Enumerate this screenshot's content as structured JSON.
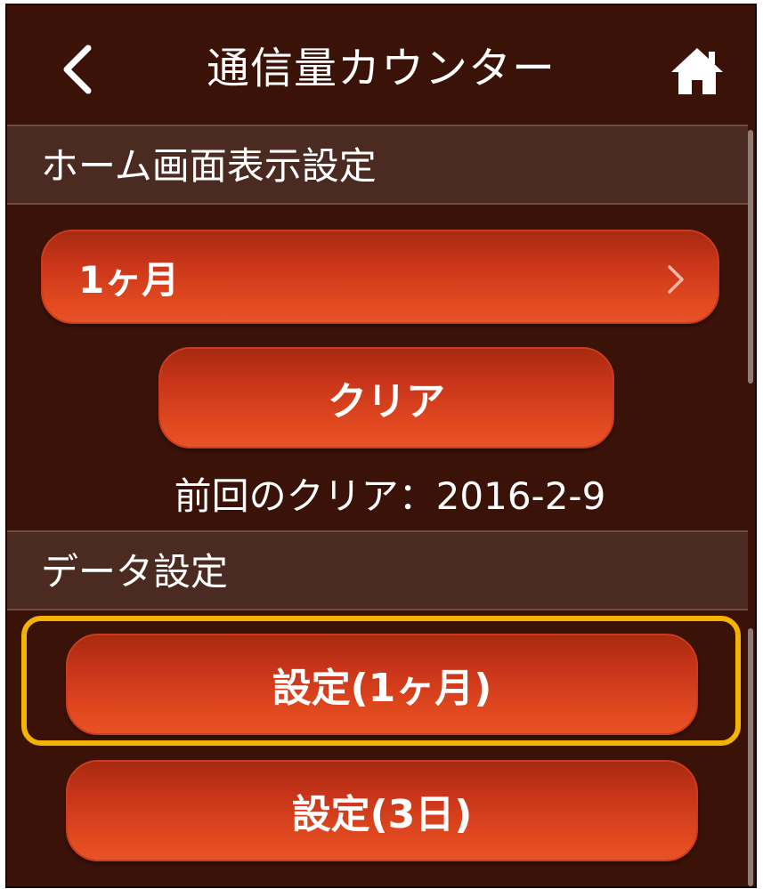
{
  "header": {
    "title": "通信量カウンター",
    "back_icon": "chevron-left-icon",
    "home_icon": "home-icon"
  },
  "sections": {
    "home_display": {
      "title": "ホーム画面表示設定",
      "period_select": {
        "value": "1ヶ月",
        "icon": "chevron-right-icon"
      },
      "clear_button": "クリア",
      "last_clear": "前回のクリア：2016-2-9"
    },
    "data_settings": {
      "title": "データ設定",
      "settings_1month": "設定(1ヶ月)",
      "settings_3days": "設定(3日)"
    }
  },
  "colors": {
    "background": "#3a1207",
    "section_header": "#4b2a22",
    "button": "#e24a1f",
    "highlight": "#f5b301"
  }
}
